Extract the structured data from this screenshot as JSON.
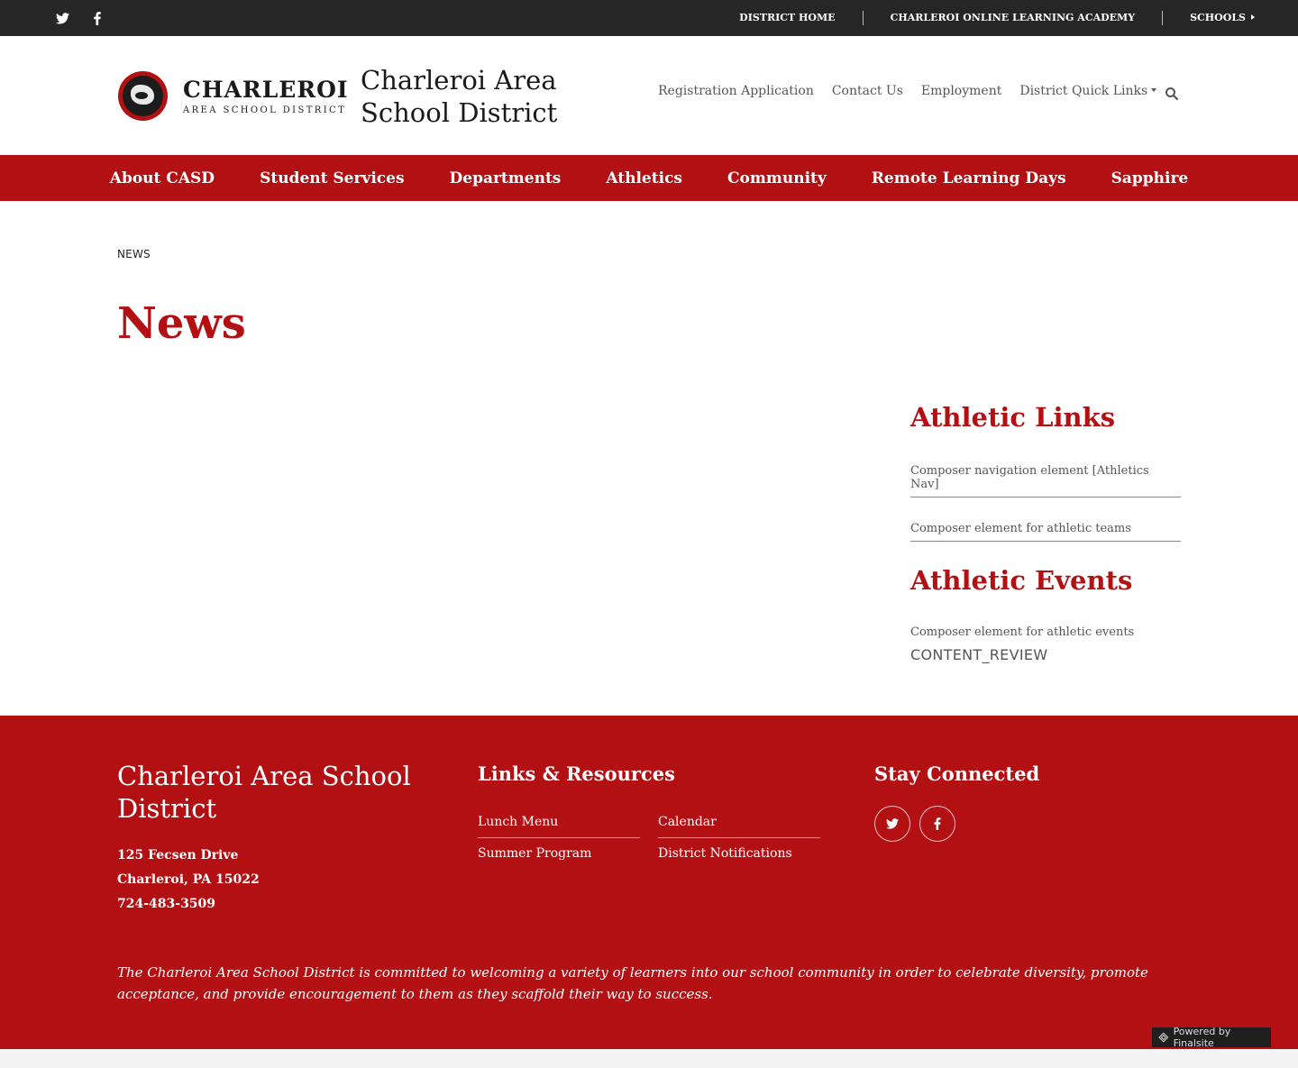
{
  "topbar": {
    "social": [
      "twitter-icon",
      "facebook-icon"
    ],
    "links": [
      "DISTRICT HOME",
      "CHARLEROI ONLINE LEARNING ACADEMY",
      "SCHOOLS"
    ]
  },
  "header": {
    "logo_big": "CHARLEROI",
    "logo_small": "AREA SCHOOL DISTRICT",
    "title_line1": "Charleroi Area",
    "title_line2": "School District",
    "nav": [
      "Registration Application",
      "Contact Us",
      "Employment",
      "District Quick Links"
    ]
  },
  "mainnav": [
    "About CASD",
    "Student Services",
    "Departments",
    "Athletics",
    "Community",
    "Remote Learning Days",
    "Sapphire"
  ],
  "content": {
    "breadcrumb": "NEWS",
    "title": "News"
  },
  "sidebar": {
    "links_heading": "Athletic Links",
    "link1": "Composer navigation element [Athletics Nav]",
    "link2": "Composer element for athletic teams",
    "events_heading": "Athletic Events",
    "events_text": "Composer element for athletic events",
    "review": "CONTENT_REVIEW"
  },
  "footer": {
    "org": "Charleroi Area School District",
    "address1": "125 Fecsen Drive",
    "address2": "Charleroi, PA  15022",
    "phone": "724-483-3509",
    "links_heading": "Links & Resources",
    "links": [
      "Lunch Menu",
      "Calendar",
      "Summer Program",
      "District Notifications"
    ],
    "stay_heading": "Stay Connected",
    "mission": "The Charleroi Area School District is committed to welcoming a variety of learners into our school community in order to celebrate diversity, promote acceptance, and provide encouragement to them as they scaffold their way to success.",
    "powered": "Powered by Finalsite"
  },
  "colors": {
    "brand_red": "#b31014",
    "topbar": "#262626"
  }
}
